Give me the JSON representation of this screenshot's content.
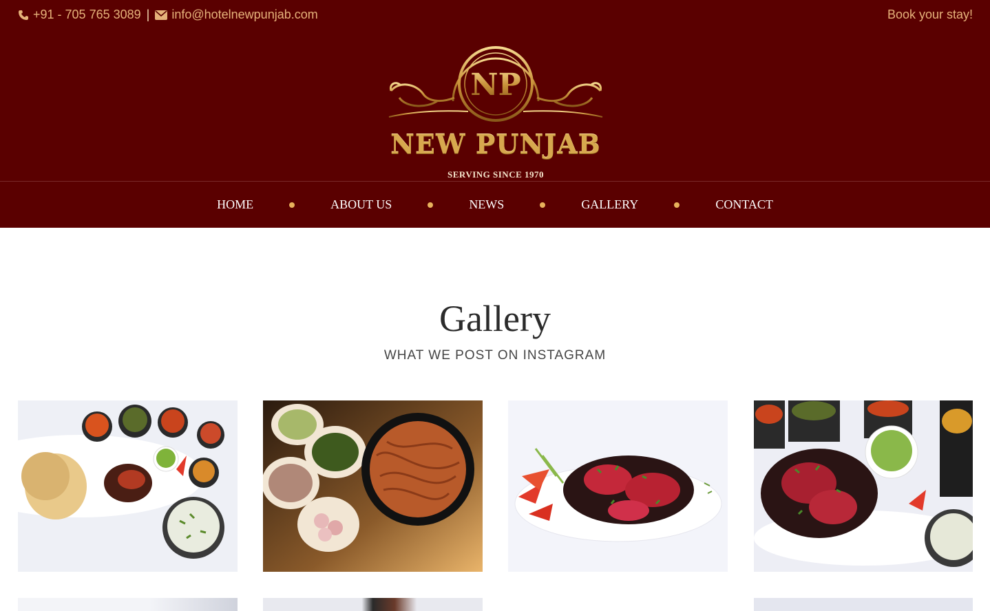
{
  "topbar": {
    "phone": "+91 - 705 765 3089",
    "separator": "|",
    "email": "info@hotelnewpunjab.com",
    "book": "Book your stay!"
  },
  "logo": {
    "monogram": "NP",
    "name": "NEW PUNJAB",
    "tagline": "SERVING SINCE 1970"
  },
  "nav": {
    "items": [
      {
        "label": "HOME"
      },
      {
        "label": "ABOUT US"
      },
      {
        "label": "NEWS"
      },
      {
        "label": "GALLERY"
      },
      {
        "label": "CONTACT"
      }
    ]
  },
  "gallery": {
    "title": "Gallery",
    "subtitle": "WHAT WE POST ON INSTAGRAM",
    "images": [
      {
        "icon": "food-platter-rotis-image"
      },
      {
        "icon": "noodles-bowls-image"
      },
      {
        "icon": "grilled-chicken-plate-image"
      },
      {
        "icon": "tandoori-chicken-chutney-image"
      }
    ]
  },
  "colors": {
    "brand_maroon": "#5a0000",
    "accent_gold": "#e8b25c",
    "topbar_text": "#e6b27a"
  }
}
